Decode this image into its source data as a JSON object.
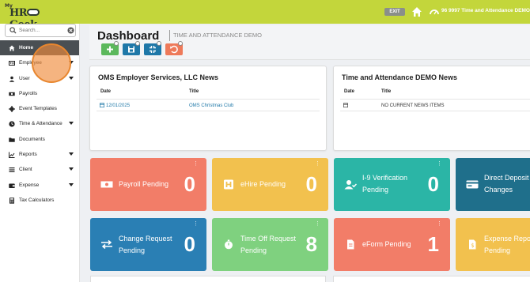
{
  "topbar": {
    "logo_my": "My",
    "logo_brand": "HR   Geek",
    "exit_label": "EXIT",
    "company": "96 9997 Time and Attendance DEMO"
  },
  "sidebar": {
    "search_placeholder": "Search...",
    "items": [
      {
        "label": "Home",
        "icon": "home-icon",
        "caret": false,
        "active": true
      },
      {
        "label": "Employee",
        "icon": "id-card-icon",
        "caret": true
      },
      {
        "label": "User",
        "icon": "user-icon",
        "caret": true
      },
      {
        "label": "Payrolls",
        "icon": "money-icon",
        "caret": false
      },
      {
        "label": "Event Templates",
        "icon": "gear-icon",
        "caret": false
      },
      {
        "label": "Time & Attendance",
        "icon": "clock-icon",
        "caret": true
      },
      {
        "label": "Documents",
        "icon": "folder-icon",
        "caret": false
      },
      {
        "label": "Reports",
        "icon": "chart-icon",
        "caret": true
      },
      {
        "label": "Client",
        "icon": "list-icon",
        "caret": true
      },
      {
        "label": "Expense",
        "icon": "wallet-icon",
        "caret": true
      },
      {
        "label": "Tax Calculators",
        "icon": "calculator-icon",
        "caret": false
      }
    ]
  },
  "dashboard": {
    "title": "Dashboard",
    "subtitle": "TIME AND ATTENDANCE DEMO"
  },
  "news_left": {
    "title": "OMS Employer Services, LLC News",
    "col_date": "Date",
    "col_title": "Title",
    "row_date": "12/01/2025",
    "row_title": "OMS Christmas Club"
  },
  "news_right": {
    "title": "Time and Attendance DEMO News",
    "col_date": "Date",
    "col_title": "Title",
    "row_title": "NO CURRENT NEWS ITEMS"
  },
  "tiles": [
    {
      "line1": "Payroll Pending",
      "line2": "",
      "count": "0",
      "color": "#f27d68"
    },
    {
      "line1": "eHire Pending",
      "line2": "",
      "count": "0",
      "color": "#f2c14e"
    },
    {
      "line1": "I-9 Verification",
      "line2": "Pending",
      "count": "0",
      "color": "#2bb5a6"
    },
    {
      "line1": "Direct Deposit",
      "line2": "Changes",
      "count": "",
      "color": "#1f6f8b"
    },
    {
      "line1": "Change Request",
      "line2": "Pending",
      "count": "0",
      "color": "#2a7fb4"
    },
    {
      "line1": "Time Off Request",
      "line2": "Pending",
      "count": "8",
      "color": "#7fd17f"
    },
    {
      "line1": "eForm Pending",
      "line2": "",
      "count": "1",
      "color": "#f27d68"
    },
    {
      "line1": "Expense Report",
      "line2": "Pending",
      "count": "",
      "color": "#f2c14e"
    }
  ],
  "colors": {
    "topbar": "#c3d63b",
    "btn_add": "#5cb85c",
    "btn_save": "#1f78a8",
    "btn_compress": "#1f78a8",
    "btn_reset": "#ee7a5a"
  }
}
